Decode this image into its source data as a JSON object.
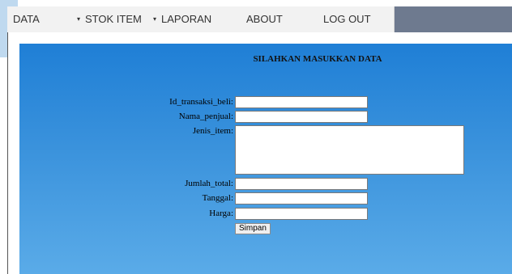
{
  "nav": {
    "items": [
      {
        "label": "DATA",
        "has_dropdown": true
      },
      {
        "label": "STOK ITEM",
        "has_dropdown": true
      },
      {
        "label": "LAPORAN",
        "has_dropdown": false
      },
      {
        "label": "ABOUT",
        "has_dropdown": false
      },
      {
        "label": "LOG OUT",
        "has_dropdown": false
      }
    ],
    "caret_glyph": "▾",
    "bar_color": "#6e7a8f",
    "menu_color": "#f2f2f2"
  },
  "form": {
    "title": "SILAHKAN MASUKKAN DATA",
    "fields": [
      {
        "label": "Id_transaksi_beli:",
        "value": ""
      },
      {
        "label": "Nama_penjual:",
        "value": ""
      },
      {
        "label": "Jenis_item:",
        "value": ""
      },
      {
        "label": "Jumlah_total:",
        "value": ""
      },
      {
        "label": "Tanggal:",
        "value": ""
      },
      {
        "label": "Harga:",
        "value": ""
      }
    ],
    "submit_label": "Simpan",
    "panel_color_top": "#1f7fd6",
    "panel_color_bottom": "#5aabe8"
  }
}
